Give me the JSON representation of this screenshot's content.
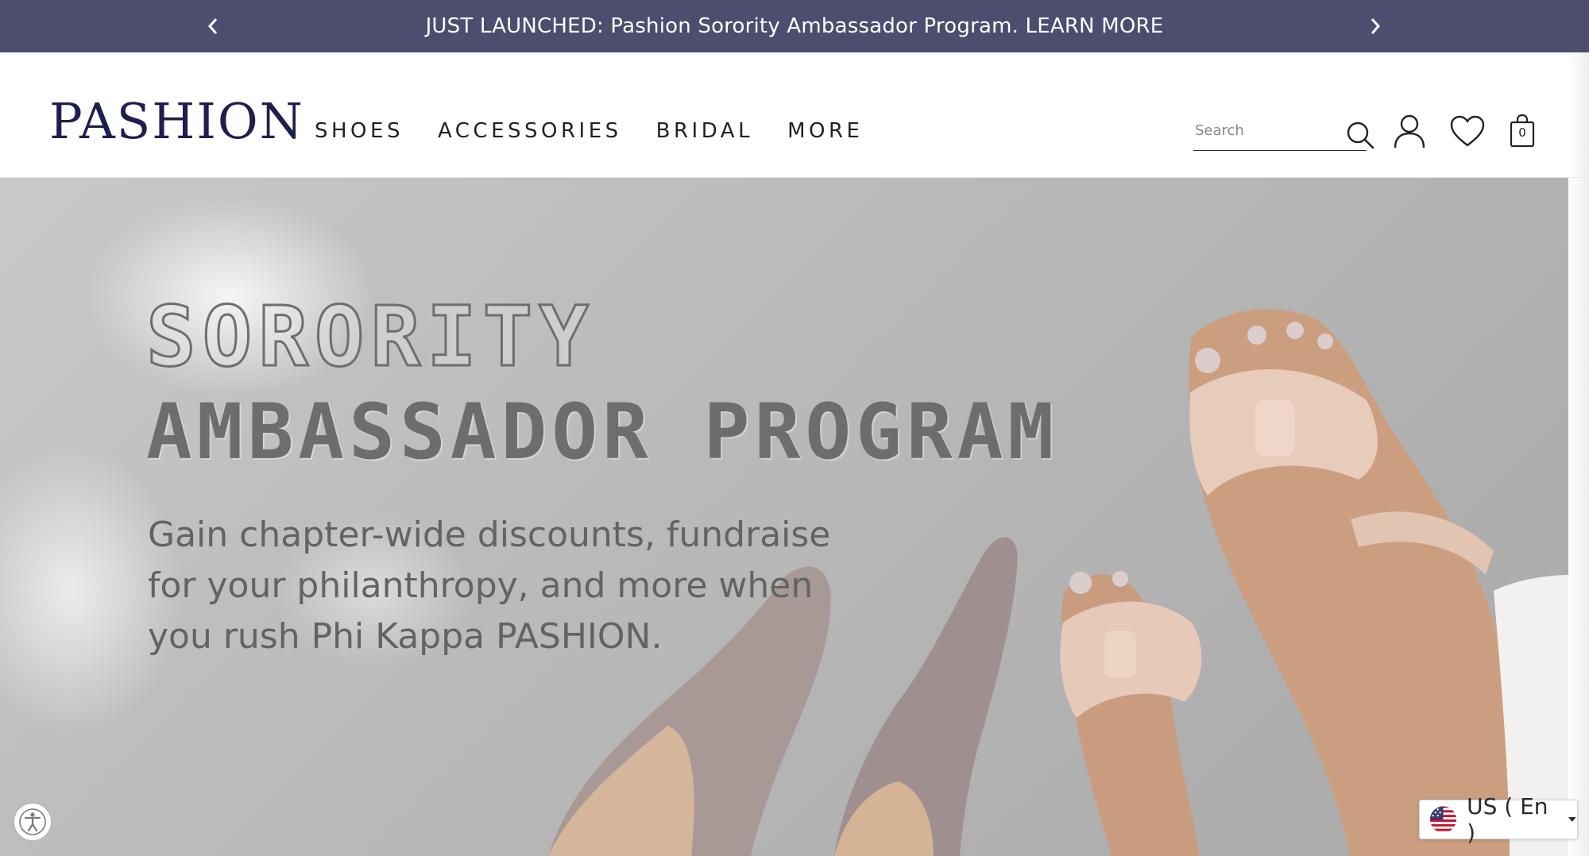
{
  "announcement": {
    "text": "JUST LAUNCHED: Pashion Sorority Ambassador Program. LEARN MORE",
    "prev_icon": "chevron-left-icon",
    "next_icon": "chevron-right-icon"
  },
  "header": {
    "logo": "PASHION",
    "nav": [
      "SHOES",
      "ACCESSORIES",
      "BRIDAL",
      "MORE"
    ],
    "search_placeholder": "Search",
    "icons": [
      "search-icon",
      "user-icon",
      "heart-icon",
      "shopping-bag-icon"
    ],
    "cart_count": "0"
  },
  "hero": {
    "title_line1": "SORORITY",
    "title_line2": "AMBASSADOR PROGRAM",
    "description": "Gain chapter-wide discounts, fundraise for your philanthropy, and more when you rush Phi Kappa PASHION."
  },
  "accessibility": {
    "icon": "accessibility-icon"
  },
  "locale": {
    "label": "US ( En )",
    "flag_icon": "us-flag-icon"
  },
  "colors": {
    "announcement_bg": "#4c4d6f",
    "logo": "#1f1f4f",
    "hero_text": "#6d6d6d"
  }
}
